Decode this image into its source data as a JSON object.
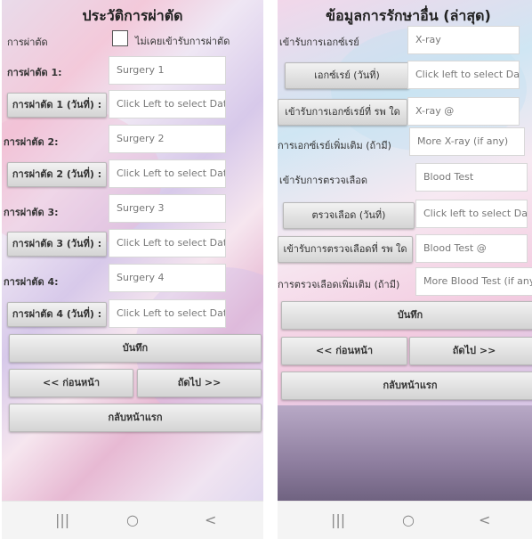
{
  "left": {
    "title": "ประวัติการผ่าตัด",
    "surgery_label": "การผ่าตัด",
    "never_checkbox_label": "ไม่เคยเข้ารับการผ่าตัด",
    "surgeries": [
      {
        "label": "การผ่าตัด 1:",
        "placeholder": "Surgery 1",
        "date_button": "การผ่าตัด 1 (วันที่) :",
        "date_placeholder": "Click Left to select Date"
      },
      {
        "label": "การผ่าตัด 2:",
        "placeholder": "Surgery 2",
        "date_button": "การผ่าตัด 2 (วันที่) :",
        "date_placeholder": "Click Left to select Date"
      },
      {
        "label": "การผ่าตัด 3:",
        "placeholder": "Surgery 3",
        "date_button": "การผ่าตัด 3 (วันที่) :",
        "date_placeholder": "Click Left to select Date"
      },
      {
        "label": "การผ่าตัด 4:",
        "placeholder": "Surgery 4",
        "date_button": "การผ่าตัด 4 (วันที่) :",
        "date_placeholder": "Click Left to select Date"
      }
    ],
    "save_button": "บันทึก",
    "prev_button": "<< ก่อนหน้า",
    "next_button": "ถัดไป >>",
    "home_button": "กลับหน้าแรก"
  },
  "right": {
    "title": "ข้อมูลการรักษาอื่น (ล่าสุด)",
    "xray_label": "เข้ารับการเอกซ์เรย์",
    "xray_value": "X-ray",
    "xray_date_button": "เอกซ์เรย์ (วันที่)",
    "xray_date_placeholder": "Click left to select Date",
    "xray_hospital_button": "เข้ารับการเอกซ์เรย์ที่ รพ ใด",
    "xray_hospital_value": "X-ray @",
    "xray_more_label": "การเอกซ์เรย์เพิ่มเติม (ถ้ามี)",
    "xray_more_value": "More X-ray (if any)",
    "blood_label": "เข้ารับการตรวจเลือด",
    "blood_value": "Blood Test",
    "blood_date_button": "ตรวจเลือด (วันที่)",
    "blood_date_placeholder": "Click left to select Date",
    "blood_hospital_button": "เข้ารับการตรวจเลือดที่ รพ ใด",
    "blood_hospital_value": "Blood Test @",
    "blood_more_label": "การตรวจเลือดเพิ่มเติม (ถ้ามี)",
    "blood_more_value": "More Blood Test (if any)",
    "save_button": "บันทึก",
    "prev_button": "<< ก่อนหน้า",
    "next_button": "ถัดไป >>",
    "home_button": "กลับหน้าแรก"
  },
  "navbar": {
    "recent_glyph": "|||",
    "home_glyph": "○",
    "back_glyph": "<"
  }
}
